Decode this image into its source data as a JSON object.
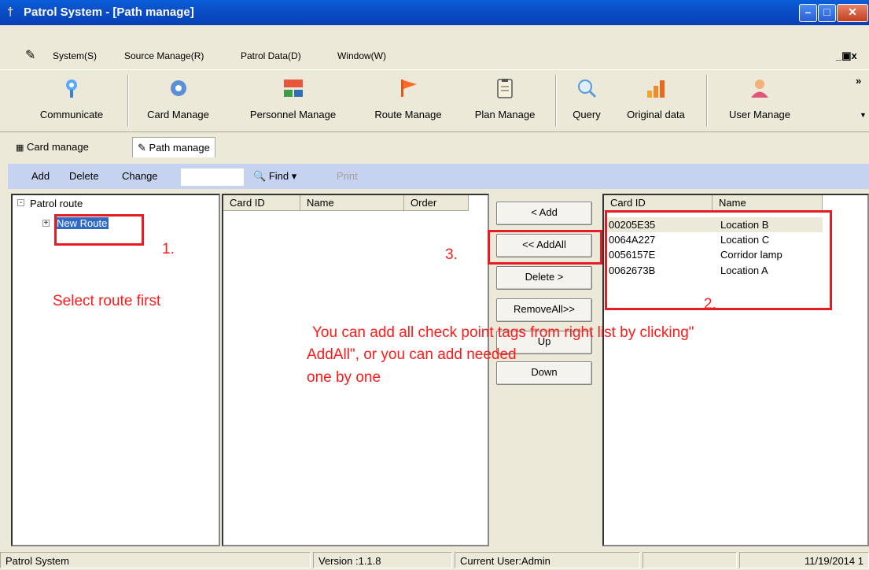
{
  "window": {
    "title": "Patrol System - [Path manage]"
  },
  "menu": [
    "System(S)",
    "Source Manage(R)",
    "Patrol Data(D)",
    "Window(W)"
  ],
  "toolbar": {
    "items": [
      {
        "label": "Communicate",
        "icon": "communicate-icon"
      },
      {
        "label": "Card Manage",
        "icon": "gear-icon"
      },
      {
        "label": "Personnel Manage",
        "icon": "personnel-icon"
      },
      {
        "label": "Route Manage",
        "icon": "flag-icon"
      },
      {
        "label": "Plan Manage",
        "icon": "clipboard-icon"
      },
      {
        "label": "Query",
        "icon": "magnifier-icon"
      },
      {
        "label": "Original data",
        "icon": "bar-chart-icon"
      },
      {
        "label": "User Manage",
        "icon": "user-icon"
      }
    ],
    "overflow": "»"
  },
  "tabs": [
    {
      "label": "Card manage"
    },
    {
      "label": "Path manage"
    }
  ],
  "actions": {
    "add": "Add",
    "delete": "Delete",
    "change": "Change",
    "find": "Find",
    "print": "Print"
  },
  "tree": {
    "root": "Patrol route",
    "child": "New Route"
  },
  "route_list": {
    "columns": [
      "Card ID",
      "Name",
      "Order"
    ]
  },
  "buttons": {
    "add": "< Add",
    "add_all": "<< AddAll",
    "delete": "Delete >",
    "remove_all": "RemoveAll>>",
    "up": "Up",
    "down": "Down"
  },
  "card_list": {
    "columns": [
      "Card ID",
      "Name"
    ],
    "rows": [
      {
        "id": "00205E35",
        "name": "Location B"
      },
      {
        "id": "0064A227",
        "name": "Location C"
      },
      {
        "id": "0056157E",
        "name": "Corridor lamp"
      },
      {
        "id": "0062673B",
        "name": "Location A"
      }
    ]
  },
  "annotations": {
    "step1": "1.",
    "step2": "2.",
    "step3": "3.",
    "select_route": "Select route first",
    "instruction_line1": "You can add all check point tags from right  list by clicking\"",
    "instruction_line2": "AddAll\", or you can add needed",
    "instruction_line3": "one by one",
    "color": "#ff1a1a"
  },
  "status": {
    "app": "Patrol System",
    "version": "Version :1.1.8",
    "user": "Current User:Admin",
    "date": "11/19/2014  1"
  }
}
